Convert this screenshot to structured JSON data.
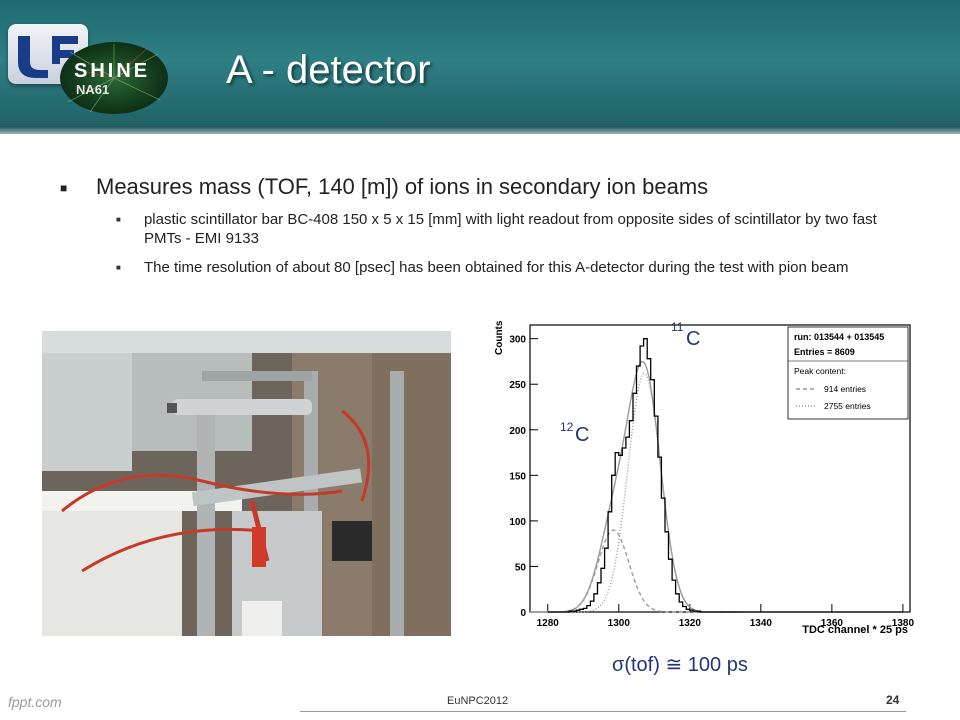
{
  "header": {
    "title": "A - detector",
    "logo_text": "SHINE",
    "logo_subtext": "NA61"
  },
  "content": {
    "bullet_main": "Measures mass (TOF, 140 [m]) of ions in secondary ion beams",
    "sub_bullets": [
      "plastic scintillator bar BC-408 150 x 5 x 15 [mm] with light readout from opposite sides of scintillator by two fast PMTs - EMI 9133",
      "The time resolution of about 80 [psec] has been obtained for this A-detector during the test with pion beam"
    ]
  },
  "chart_data": {
    "type": "histogram",
    "xlabel": "TDC channel * 25 ps",
    "ylabel": "Counts",
    "xlim": [
      1275,
      1382
    ],
    "ylim": [
      0,
      315
    ],
    "x_ticks": [
      1280,
      1300,
      1320,
      1340,
      1360,
      1380
    ],
    "y_ticks": [
      0,
      50,
      100,
      150,
      200,
      250,
      300
    ],
    "stats_box": {
      "run": "run: 013544 + 013545",
      "entries": "Entries = 8609",
      "peak_header": "Peak content:",
      "peak1": "914 entries",
      "peak2": "2755 entries"
    },
    "annotations": [
      {
        "sup": "11",
        "base": "C",
        "x": 1307
      },
      {
        "sup": "12",
        "base": "C",
        "x": 1297
      }
    ],
    "peaks": [
      {
        "mean": 1298.5,
        "sigma": 4.3,
        "amplitude": 90
      },
      {
        "mean": 1307.2,
        "sigma": 4.6,
        "amplitude": 262
      }
    ],
    "histogram_bins": {
      "x": [
        1286,
        1287,
        1288,
        1289,
        1290,
        1291,
        1292,
        1293,
        1294,
        1295,
        1296,
        1297,
        1298,
        1299,
        1300,
        1301,
        1302,
        1303,
        1304,
        1305,
        1306,
        1307,
        1308,
        1309,
        1310,
        1311,
        1312,
        1313,
        1314,
        1315,
        1316,
        1317,
        1318,
        1319,
        1320,
        1321,
        1322
      ],
      "y": [
        1,
        1,
        2,
        3,
        4,
        7,
        12,
        20,
        32,
        48,
        70,
        110,
        150,
        175,
        172,
        180,
        192,
        210,
        240,
        270,
        292,
        300,
        278,
        255,
        215,
        170,
        125,
        88,
        58,
        35,
        20,
        11,
        6,
        3,
        2,
        1,
        1
      ]
    }
  },
  "caption": "σ(tof) ≅ 100 ps",
  "footer": {
    "brand": "fppt.com",
    "conference": "EuNPC2012",
    "page": "24"
  }
}
